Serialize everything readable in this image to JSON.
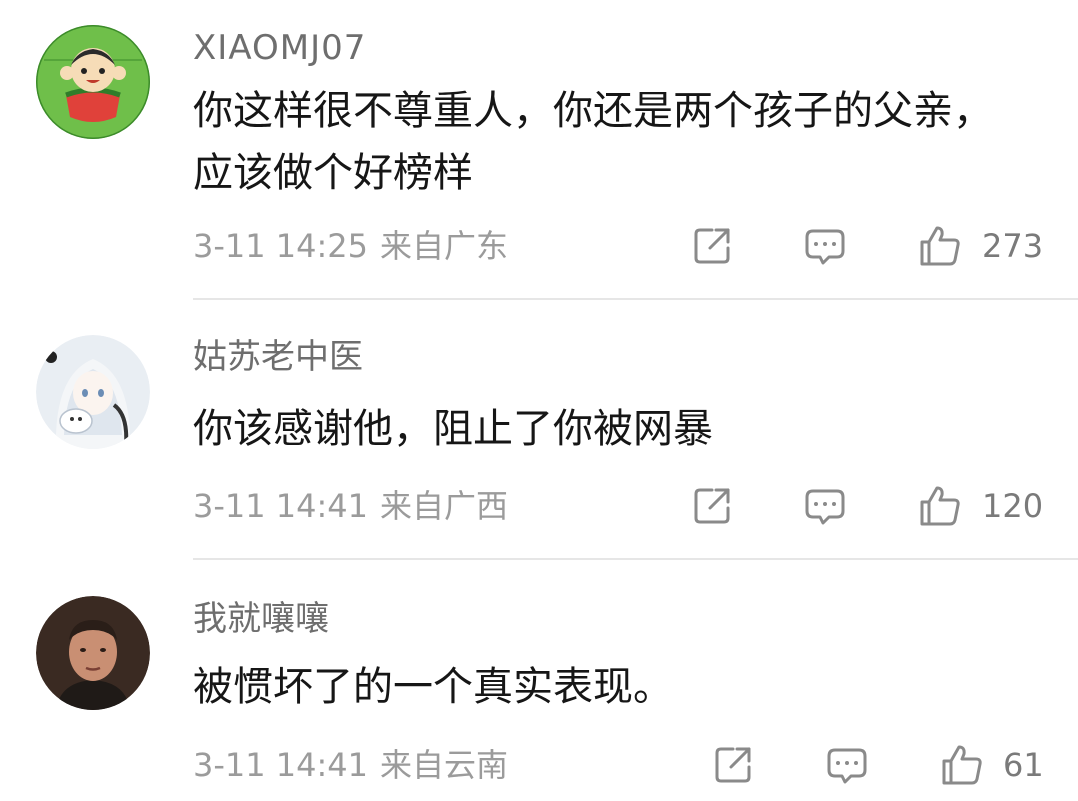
{
  "comments": [
    {
      "username": "XIAOMJ07",
      "text": "你这样很不尊重人，你还是两个孩子的父亲，应该做个好榜样",
      "time": "3-11 14:25",
      "location": "来自广东",
      "likes": "273",
      "avatar_icon": "watermelon-cartoon-avatar"
    },
    {
      "username": "姑苏老中医",
      "text": "你该感谢他，阻止了你被网暴",
      "time": "3-11 14:41",
      "location": "来自广西",
      "likes": "120",
      "avatar_icon": "anime-girl-avatar"
    },
    {
      "username": "我就嚷嚷",
      "text": "被惯坏了的一个真实表现。",
      "time": "3-11 14:41",
      "location": "来自云南",
      "likes": "61",
      "avatar_icon": "man-photo-avatar"
    }
  ],
  "icons": {
    "share": "share-icon",
    "reply": "comment-bubble-icon",
    "like": "thumbs-up-icon"
  },
  "colors": {
    "username": "#6e6e6e",
    "text": "#161616",
    "meta": "#9b9b9b",
    "divider": "#e6e6e6"
  }
}
